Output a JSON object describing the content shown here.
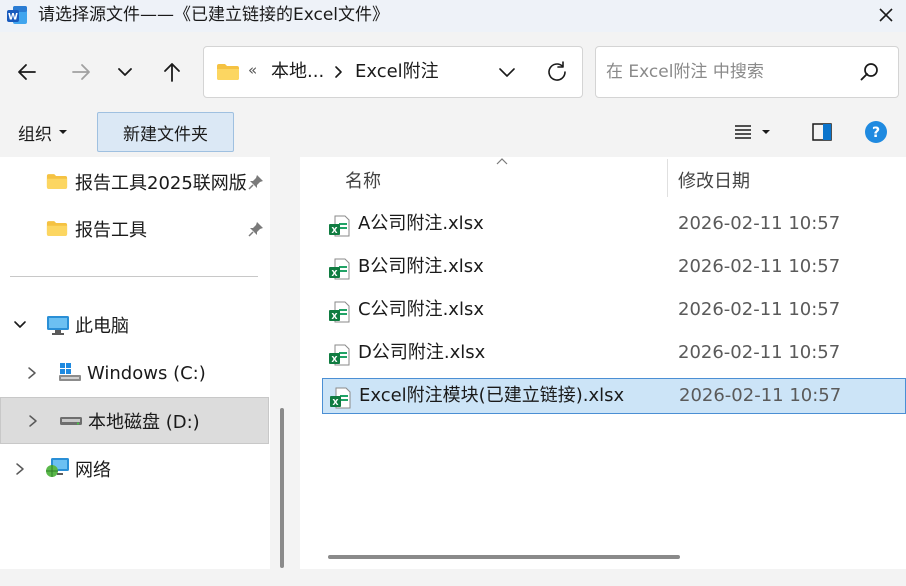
{
  "window": {
    "title": "请选择源文件——《已建立链接的Excel文件》",
    "app_icon": "word-icon"
  },
  "nav": {
    "icons": [
      "back-arrow-icon",
      "forward-arrow-icon",
      "chevron-down-icon",
      "up-arrow-icon"
    ]
  },
  "address": {
    "overflow": "«",
    "crumbs": [
      "本地...",
      "Excel附注"
    ]
  },
  "search": {
    "placeholder": "在 Excel附注 中搜索"
  },
  "toolbar": {
    "organize_label": "组织",
    "new_folder_label": "新建文件夹"
  },
  "sidebar": {
    "items": [
      {
        "label": "报告工具2025联网版",
        "icon": "folder-icon",
        "pinned": true
      },
      {
        "label": "报告工具",
        "icon": "folder-icon",
        "pinned": true
      },
      {
        "label": "此电脑",
        "icon": "monitor-icon",
        "expanded": true
      },
      {
        "label": "Windows (C:)",
        "icon": "windows-drive-icon"
      },
      {
        "label": "本地磁盘 (D:)",
        "icon": "drive-icon",
        "selected": true
      },
      {
        "label": "网络",
        "icon": "network-icon"
      }
    ]
  },
  "files": {
    "columns": {
      "name": "名称",
      "date": "修改日期"
    },
    "rows": [
      {
        "name": "A公司附注.xlsx",
        "date": "2026-02-11 10:57",
        "icon": "excel-file-icon"
      },
      {
        "name": "B公司附注.xlsx",
        "date": "2026-02-11 10:57",
        "icon": "excel-file-icon"
      },
      {
        "name": "C公司附注.xlsx",
        "date": "2026-02-11 10:57",
        "icon": "excel-file-icon"
      },
      {
        "name": "D公司附注.xlsx",
        "date": "2026-02-11 10:57",
        "icon": "excel-file-icon"
      },
      {
        "name": "Excel附注模块(已建立链接).xlsx",
        "date": "2026-02-11 10:57",
        "icon": "excel-file-icon",
        "selected": true
      }
    ]
  },
  "colors": {
    "selection_bg": "#cce4f7",
    "selection_border": "#4b8fd4",
    "accent": "#0a74cc",
    "folder": "#f5c242"
  }
}
